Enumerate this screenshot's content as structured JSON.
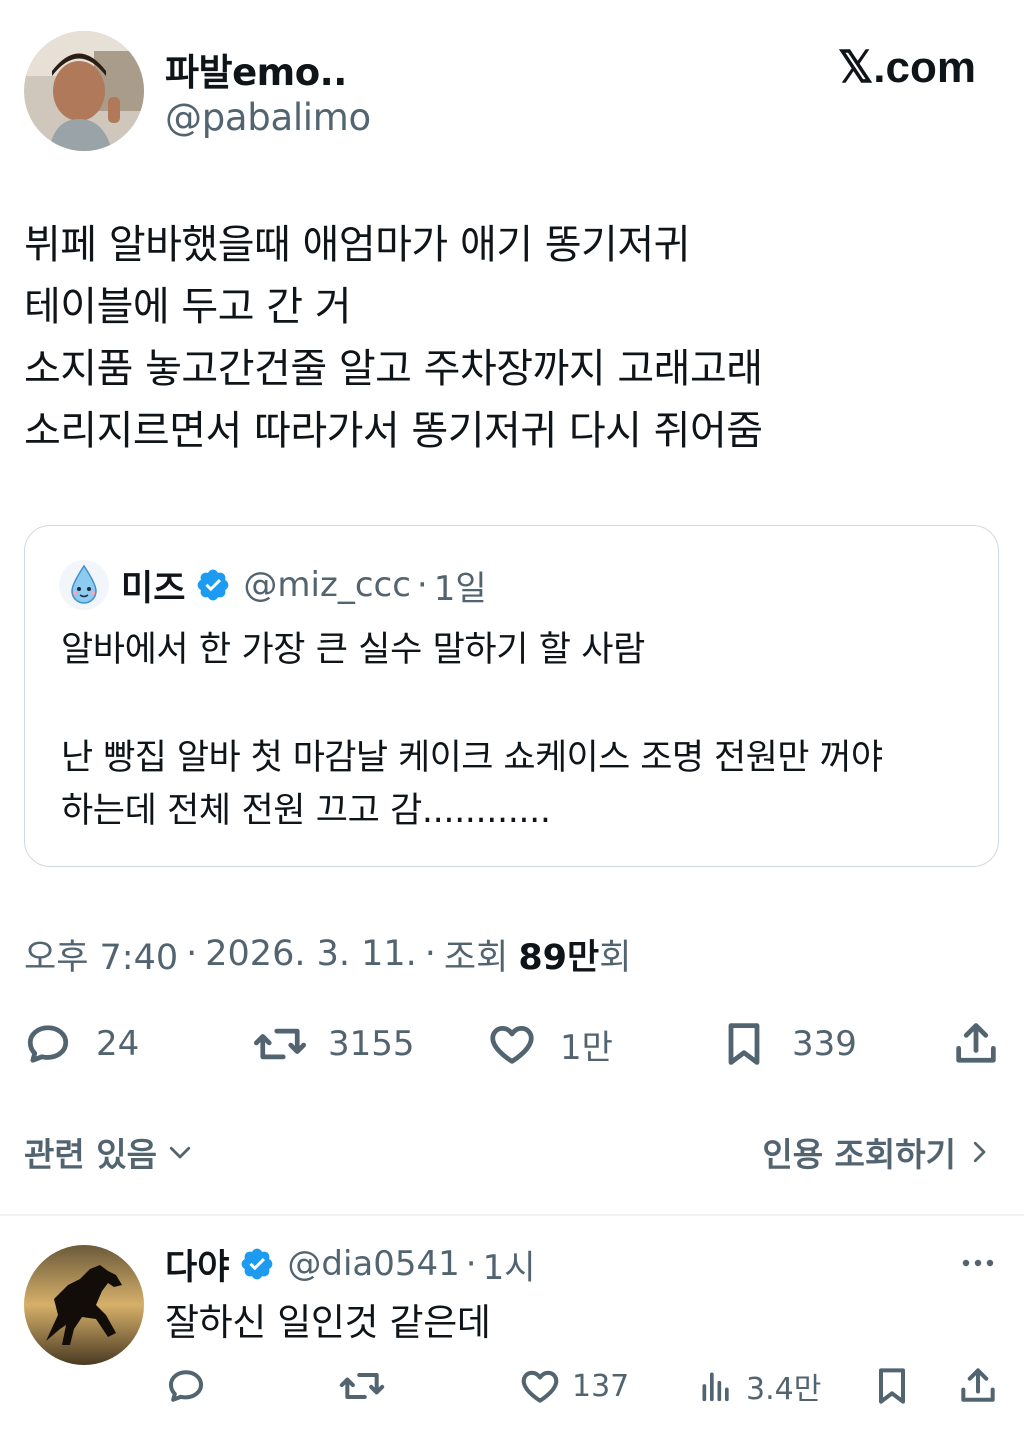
{
  "header": {
    "display_name": "파발emo..",
    "handle": "@pabalimo",
    "brand": "𝕏.com"
  },
  "tweet": {
    "lines": [
      "뷔페 알바했을때 애엄마가 애기 똥기저귀",
      "테이블에 두고 간 거",
      "소지품 놓고간건줄 알고 주차장까지 고래고래",
      "소리지르면서 따라가서 똥기저귀 다시 쥐어줌"
    ]
  },
  "quote": {
    "name": "미즈",
    "handle": "@miz_ccc",
    "sep": "·",
    "time": "1일",
    "lines": [
      "알바에서 한 가장 큰 실수 말하기 할 사람",
      "난 빵집 알바 첫 마감날 케이크 쇼케이스 조명 전원만 꺼야",
      "하는데 전체 전원 끄고 감............"
    ]
  },
  "meta": {
    "time": "오후 7:40",
    "sep1": "·",
    "date": "2026. 3. 11.",
    "sep2": "·",
    "views_prefix": "조회",
    "views_count": "89만",
    "views_suffix": "회"
  },
  "actions": {
    "replies": "24",
    "retweets": "3155",
    "likes": "1만",
    "bookmarks": "339"
  },
  "related": {
    "left_label": "관련 있음",
    "right_label": "인용 조회하기"
  },
  "reply": {
    "name": "다야",
    "handle": "@dia0541",
    "sep": "·",
    "time": "1시",
    "text": "잘하신 일인것 같은데",
    "likes": "137",
    "views": "3.4만"
  },
  "colors": {
    "verified": "#1d9bf0",
    "text": "#0f1419",
    "muted": "#536471",
    "border": "#cfd9de"
  }
}
